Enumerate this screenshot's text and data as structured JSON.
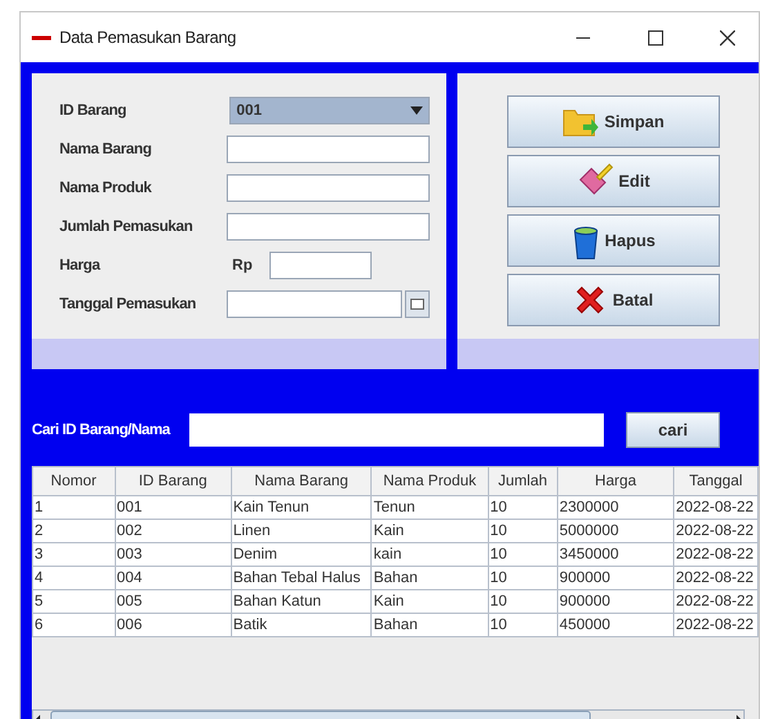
{
  "window": {
    "title": "Data Pemasukan Barang"
  },
  "form": {
    "fields": [
      {
        "label": "ID Barang",
        "kind": "combo",
        "value": "001"
      },
      {
        "label": "Nama Barang",
        "kind": "text"
      },
      {
        "label": "Nama Produk",
        "kind": "text"
      },
      {
        "label": "Jumlah Pemasukan",
        "kind": "text"
      },
      {
        "label": "Harga",
        "kind": "price",
        "prefix": "Rp"
      },
      {
        "label": "Tanggal Pemasukan",
        "kind": "date"
      }
    ]
  },
  "buttons": [
    {
      "label": "Simpan",
      "kind": "save"
    },
    {
      "label": "Edit",
      "kind": "edit"
    },
    {
      "label": "Hapus",
      "kind": "delete"
    },
    {
      "label": "Batal",
      "kind": "cancel"
    }
  ],
  "search": {
    "label": "Cari ID Barang/Nama",
    "button": "cari"
  },
  "table": {
    "columns": [
      "Nomor",
      "ID Barang",
      "Nama Barang",
      "Nama Produk",
      "Jumlah",
      "Harga",
      "Tanggal"
    ],
    "rows": [
      [
        "1",
        "001",
        "Kain Tenun",
        "Tenun",
        "10",
        "2300000",
        "2022-08-22"
      ],
      [
        "2",
        "002",
        "Linen",
        "Kain",
        "10",
        "5000000",
        "2022-08-22"
      ],
      [
        "3",
        "003",
        "Denim",
        "kain",
        "10",
        "3450000",
        "2022-08-22"
      ],
      [
        "4",
        "004",
        "Bahan Tebal Halus",
        "Bahan",
        "10",
        "900000",
        "2022-08-22"
      ],
      [
        "5",
        "005",
        "Bahan Katun",
        "Kain",
        "10",
        "900000",
        "2022-08-22"
      ],
      [
        "6",
        "006",
        "Batik",
        "Bahan",
        "10",
        "450000",
        "2022-08-22"
      ]
    ]
  }
}
